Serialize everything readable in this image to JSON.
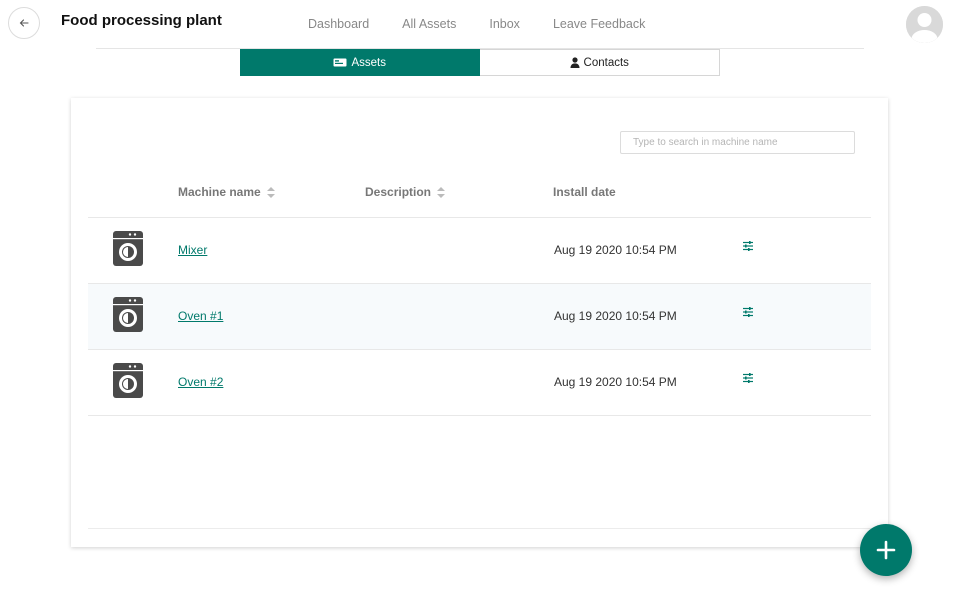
{
  "header": {
    "title": "Food processing plant",
    "nav": [
      "Dashboard",
      "All Assets",
      "Inbox",
      "Leave Feedback"
    ]
  },
  "tabs": {
    "assets_label": "Assets",
    "contacts_label": "Contacts",
    "active": "Assets"
  },
  "search": {
    "placeholder": "Type to search in machine name",
    "value": ""
  },
  "table": {
    "columns": [
      "Machine name",
      "Description",
      "Install date"
    ],
    "rows": [
      {
        "name": "Mixer",
        "description": "",
        "install_date": "Aug 19 2020 10:54 PM"
      },
      {
        "name": "Oven #1",
        "description": "",
        "install_date": "Aug 19 2020 10:54 PM"
      },
      {
        "name": "Oven #2",
        "description": "",
        "install_date": "Aug 19 2020 10:54 PM"
      }
    ]
  },
  "icons": {
    "back": "arrow-left-icon",
    "avatar": "user-avatar-icon",
    "assets_tab": "id-card-icon",
    "contacts_tab": "person-icon",
    "machine": "washing-machine-icon",
    "row_action": "sliders-icon",
    "fab": "plus-icon"
  },
  "colors": {
    "accent": "#00796b",
    "text_muted": "#888888",
    "row_alt": "#f7fafc"
  }
}
